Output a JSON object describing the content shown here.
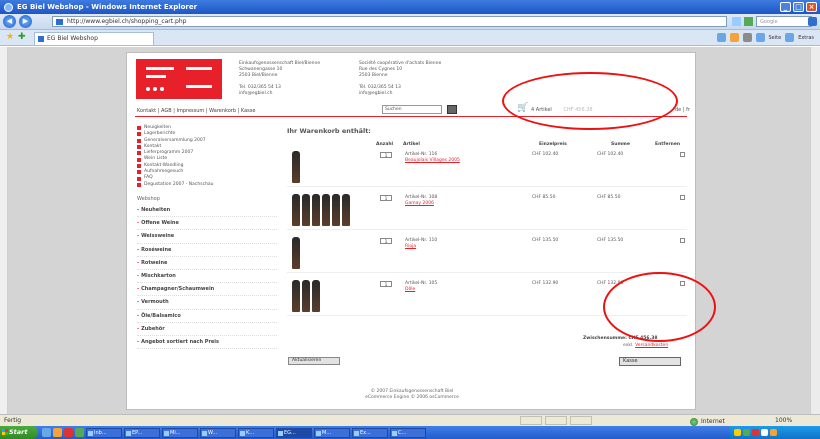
{
  "window": {
    "title": "EG Biel Webshop - Windows Internet Explorer",
    "url": "http://www.egbiel.ch/shopping_cart.php",
    "tab_title": "EG Biel Webshop",
    "search_placeholder": "Google",
    "page_menu": "Seite",
    "extras_menu": "Extras"
  },
  "header": {
    "company_lines": [
      "Einkaufsgenossenschaft Biel/Bienne",
      "Schwanengasse 10",
      "2503 Biel/Bienne",
      "",
      "Tel. 032/365 54 13",
      "info@egbiel.ch"
    ],
    "company2_lines": [
      "Société coopérative d'achats Bienne",
      "Rue des Cygnes 10",
      "2503 Bienne",
      "",
      "Tél. 032/365 54 13",
      "info@egbiel.ch"
    ],
    "topnav": "Kontakt | AGB | Impressum | Warenkorb | Kasse",
    "search_value": "Suchen",
    "cart_label": "4 Artikel",
    "cart_muted": "CHF 456.38",
    "lang": "de | fr"
  },
  "sidebar": {
    "items": [
      "Neuigkeiten",
      "Lagerberichte",
      "Generalversammlung 2007",
      "Kontakt",
      "Lieferprogramm 2007",
      "Wein Liste",
      "Kontakt-Wandling",
      "Aufnahmegesuch",
      "FAQ",
      "Degustation 2007 - Nachschau"
    ],
    "shop_title": "Webshop",
    "categories": [
      "Neuheiten",
      "Offene Weine",
      "Weissweine",
      "Roséweine",
      "Rotweine",
      "Mischkarton",
      "Champagner/Schaumwein",
      "Vermouth",
      "Öle/Balsamico",
      "Zubehör",
      "Angebot sortiert nach Preis"
    ]
  },
  "cart": {
    "title": "Ihr Warenkorb enthält:",
    "columns": [
      "Anzahl",
      "Artikel",
      "Einzelpreis",
      "Summe",
      "Entfernen"
    ],
    "rows": [
      {
        "bottles": 1,
        "qty": "1",
        "artnr": "Artikel-Nr. 116",
        "name": "Beaujolais Villages 2005",
        "price": "CHF 102.40",
        "sum": "CHF 102.40"
      },
      {
        "bottles": 6,
        "qty": "1",
        "artnr": "Artikel-Nr. 108",
        "name": "Gamay 2006",
        "price": "CHF 85.50",
        "sum": "CHF 85.50"
      },
      {
        "bottles": 1,
        "qty": "1",
        "artnr": "Artikel-Nr. 110",
        "name": "Rioja",
        "price": "CHF 135.50",
        "sum": "CHF 135.50"
      },
      {
        "bottles": 3,
        "qty": "1",
        "artnr": "Artikel-Nr. 105",
        "name": "Dôle",
        "price": "CHF 132.90",
        "sum": "CHF 132.90"
      }
    ],
    "total_label": "Zwischensumme: CHF 456.38",
    "shipping_prefix": "exkl.",
    "shipping_link": "Versandkosten",
    "back_button": "Aktualisieren",
    "checkout_button": "Kasse"
  },
  "footer": {
    "line1": "© 2007 Einkaufsgenossenschaft Biel",
    "line2": "eCommerce Engine © 2006 osCommerce"
  },
  "statusbar": {
    "left": "Fertig",
    "zone": "Internet",
    "zoom": "100%"
  },
  "taskbar": {
    "start": "Start",
    "tasks": [
      "Inb...",
      "EP...",
      "Mi...",
      "W...",
      "K...",
      "EG...",
      "M...",
      "Ex...",
      "C..."
    ]
  }
}
